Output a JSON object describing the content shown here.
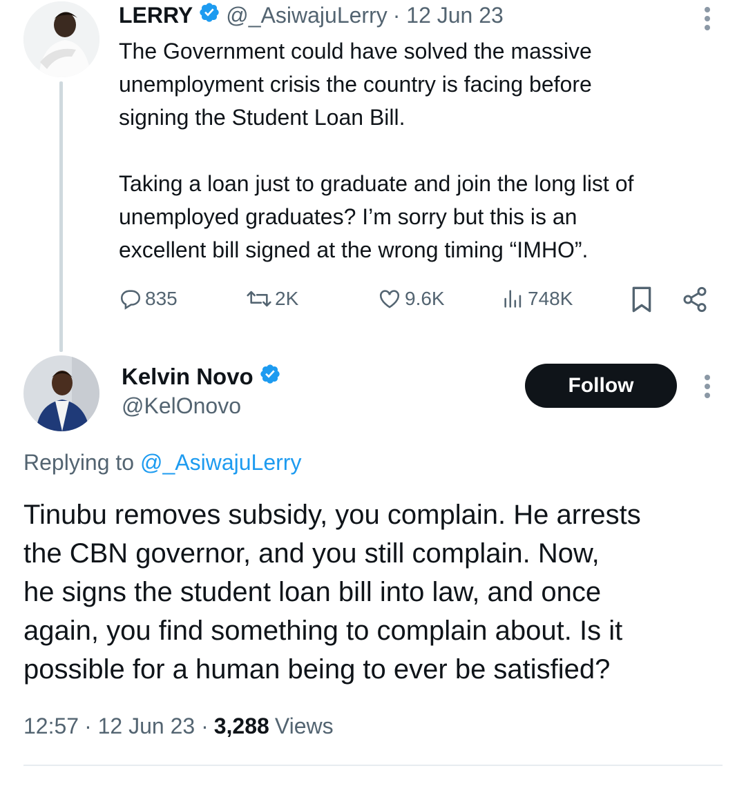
{
  "parent_tweet": {
    "name": "LERRY",
    "handle": "@_AsiwajuLerry",
    "date": "· 12 Jun 23",
    "text": "The Government could have solved the massive\nunemployment crisis the country is facing before\nsigning the Student Loan Bill.\n\nTaking a loan just to graduate and join the long list of\nunemployed graduates? I’m sorry but this is an\nexcellent bill signed at the wrong timing “IMHO”.",
    "stats": {
      "replies": "835",
      "retweets": "2K",
      "likes": "9.6K",
      "views": "748K"
    }
  },
  "reply_tweet": {
    "name": "Kelvin Novo",
    "handle": "@KelOnovo",
    "follow_label": "Follow",
    "replying_prefix": "Replying to",
    "replying_handle": "@_AsiwajuLerry",
    "text": "Tinubu removes subsidy, you complain. He arrests\nthe CBN governor, and you still complain. Now,\nhe signs the student loan bill into law, and once\nagain, you find something to complain about. Is it\npossible for a human being to ever be satisfied?",
    "time": "12:57",
    "date": "· 12 Jun 23 ·",
    "views_count": "3,288",
    "views_label": "Views"
  },
  "colors": {
    "verified": "#1d9bf0",
    "link": "#1d9bf0",
    "muted": "#536471",
    "text": "#0f1419"
  },
  "icons": [
    "verified-badge-icon",
    "reply-icon",
    "retweet-icon",
    "like-icon",
    "views-icon",
    "bookmark-icon",
    "share-icon",
    "more-icon"
  ]
}
